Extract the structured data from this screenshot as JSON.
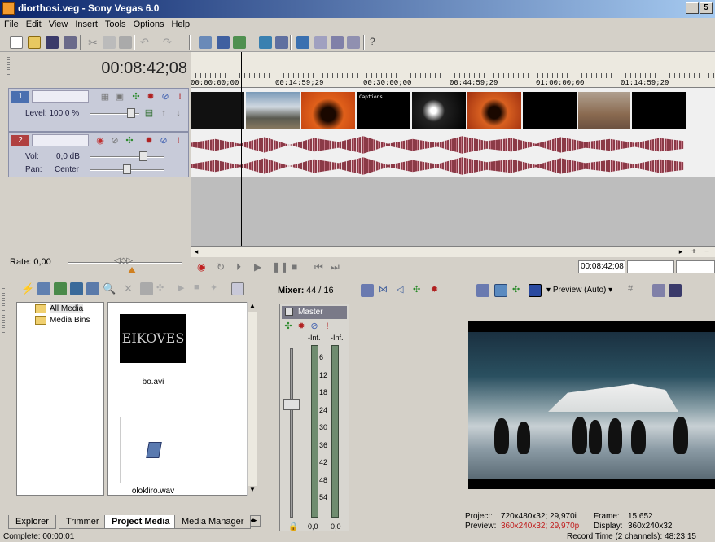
{
  "window": {
    "title": "diorthosi.veg - Sony Vegas 6.0",
    "min": "_",
    "restore": "5"
  },
  "menu": [
    "File",
    "Edit",
    "View",
    "Insert",
    "Tools",
    "Options",
    "Help"
  ],
  "timeline": {
    "timecode": "00:08:42;08",
    "ruler_labels": [
      "00:00:00;00",
      "00:14:59;29",
      "00:30:00;00",
      "00:44:59;29",
      "01:00:00;00",
      "01:14:59;29"
    ],
    "video_track": {
      "number": "1",
      "level_label": "Level: 100.0 %"
    },
    "audio_track": {
      "number": "2",
      "vol_label": "Vol:",
      "vol_value": "0,0 dB",
      "pan_label": "Pan:",
      "pan_value": "Center"
    },
    "clip_title": "Captions"
  },
  "rate": {
    "label": "Rate: 0,00"
  },
  "transport": {
    "time_field": "00:08:42;08"
  },
  "explorer": {
    "tree": [
      "All Media",
      "Media Bins"
    ],
    "media": [
      {
        "name": "bo.avi",
        "thumb_text": "EIKOVES"
      },
      {
        "name": "olokliro.wav"
      }
    ],
    "tabs": [
      "Explorer",
      "Trimmer",
      "Project Media",
      "Media Manager"
    ]
  },
  "mixer": {
    "title": "Mixer:",
    "count": "44 / 16",
    "bus": "Master",
    "peak_l": "-Inf.",
    "peak_r": "-Inf.",
    "scale": [
      "6",
      "12",
      "18",
      "24",
      "30",
      "36",
      "42",
      "48",
      "54"
    ],
    "val_l": "0,0",
    "val_r": "0,0"
  },
  "preview": {
    "mode": "Preview (Auto)",
    "project_label": "Project:",
    "project_value": "720x480x32; 29,970i",
    "preview_label": "Preview:",
    "preview_value": "360x240x32; 29,970p",
    "frame_label": "Frame:",
    "frame_value": "15.652",
    "display_label": "Display:",
    "display_value": "360x240x32"
  },
  "status": {
    "left": "Complete: 00:00:01",
    "right": "Record Time (2 channels): 48:23:15"
  },
  "colors": {
    "audio_wave": "#8b3a47",
    "title_gradient_start": "#0a246a"
  }
}
